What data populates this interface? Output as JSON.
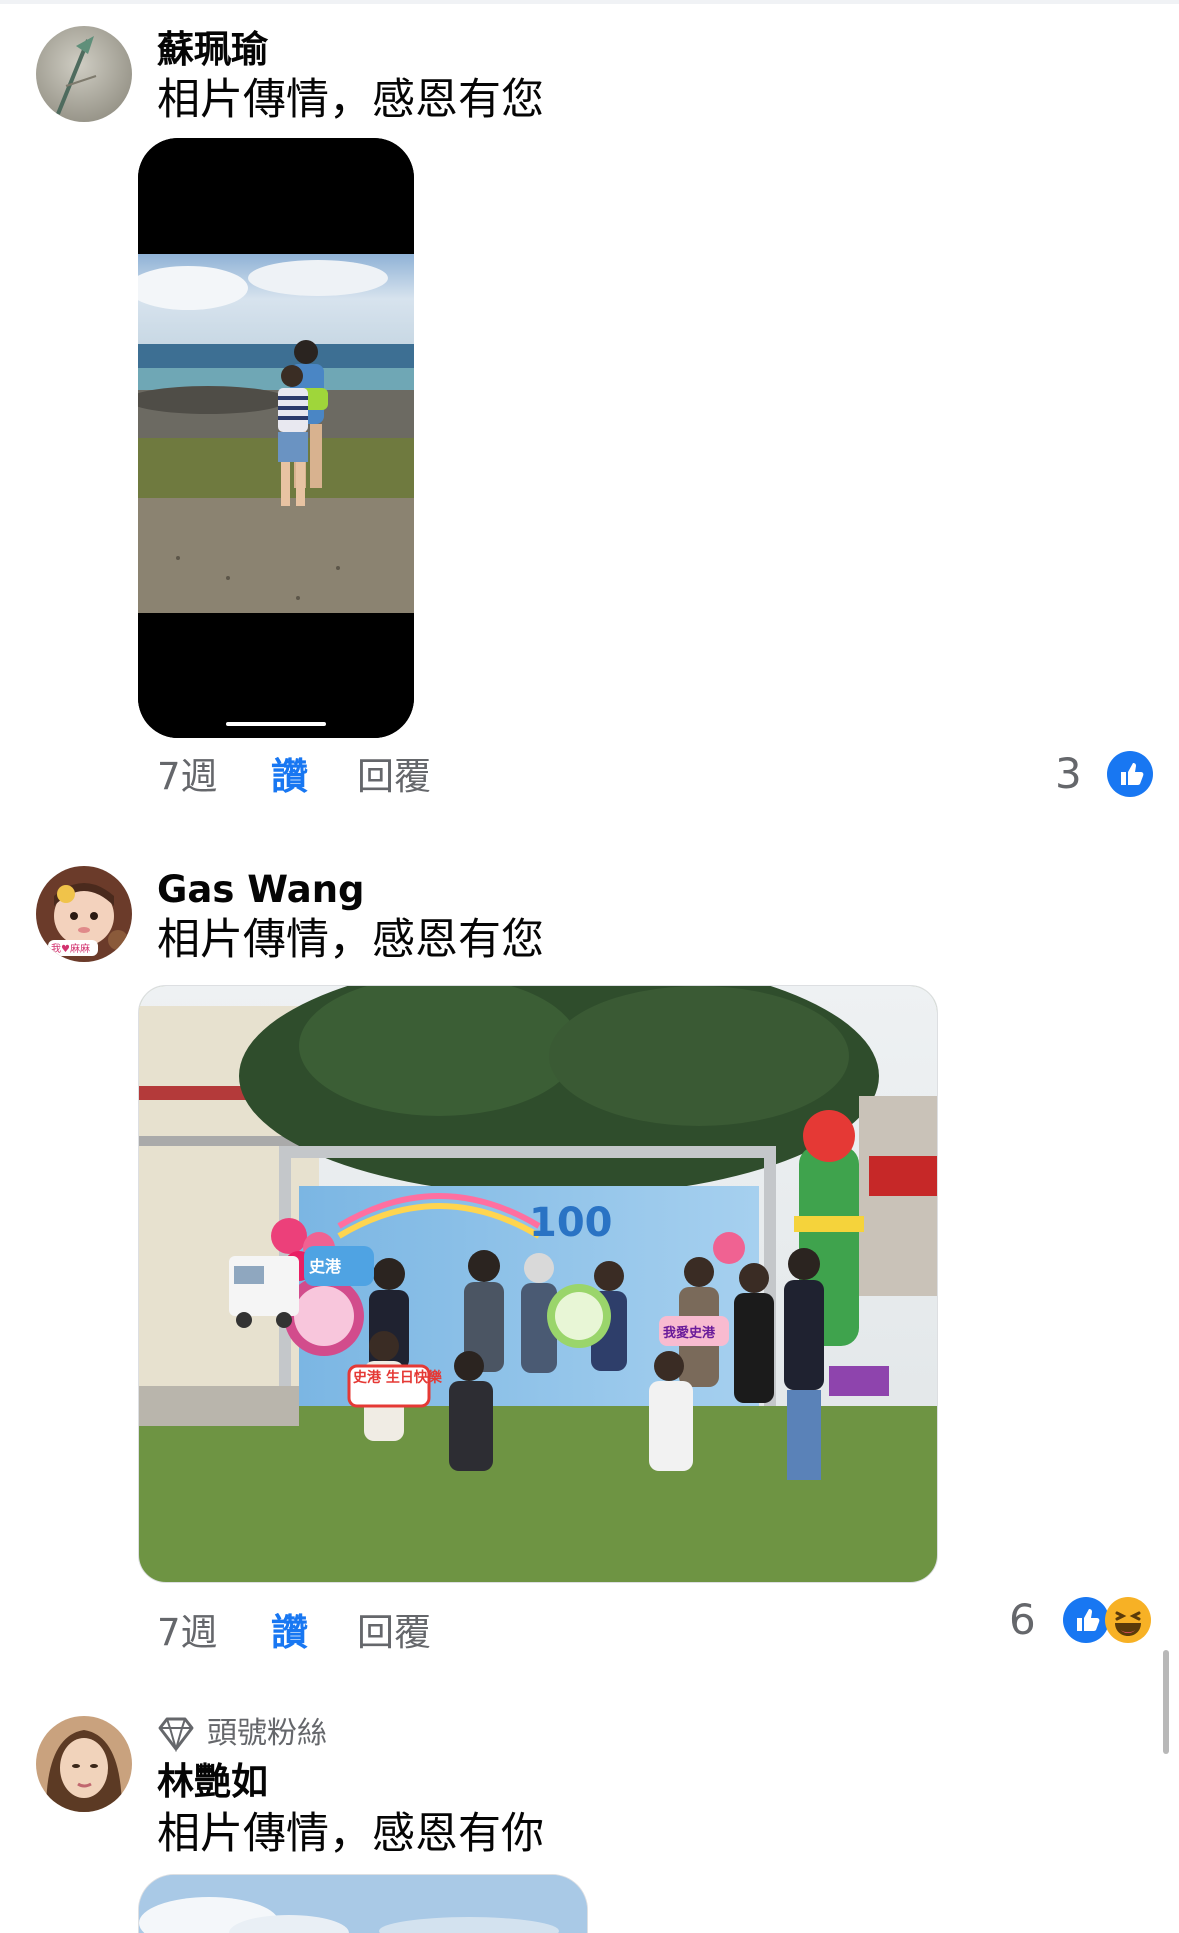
{
  "comments": [
    {
      "author": "蘇珮瑜",
      "text": "相片傳情，感恩有您",
      "time": "7週",
      "like_label": "讚",
      "reply_label": "回覆",
      "reaction_count": "3",
      "reactions": [
        "like-icon"
      ]
    },
    {
      "author": "Gas Wang",
      "text": "相片傳情，感恩有您",
      "time": "7週",
      "like_label": "讚",
      "reply_label": "回覆",
      "reaction_count": "6",
      "reactions": [
        "like-icon",
        "haha-icon"
      ],
      "avatar_sticker_text": "我♥麻麻",
      "photo_sign_texts": [
        "我愛史港",
        "史港 生日快樂",
        "史港",
        "100"
      ]
    },
    {
      "badge": "頭號粉絲",
      "author": "林艷如",
      "text": "相片傳情，感恩有你"
    }
  ],
  "colors": {
    "like_blue": "#1877f2",
    "secondary_text": "#65676b",
    "primary_text": "#050505",
    "haha_yellow": "#f7b125"
  }
}
